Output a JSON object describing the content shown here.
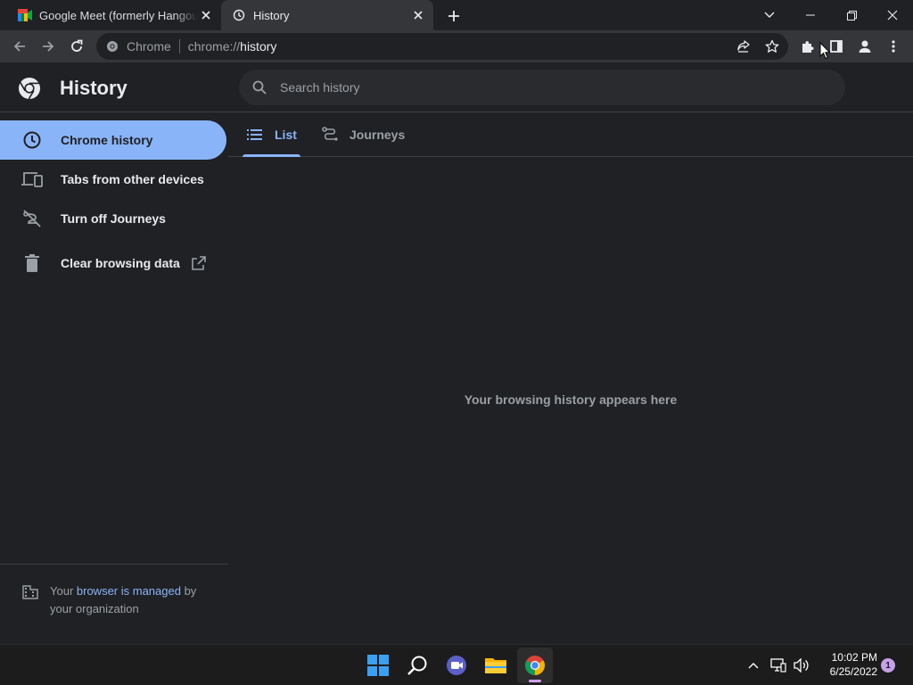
{
  "browser": {
    "tabs": [
      {
        "title": "Google Meet (formerly Hangouts)",
        "favicon": "google-meet-icon",
        "active": false
      },
      {
        "title": "History",
        "favicon": "history-clock-icon",
        "active": true
      }
    ],
    "omnibox": {
      "site_name": "Chrome",
      "url_scheme": "chrome://",
      "url_host": "history"
    }
  },
  "page": {
    "title": "History",
    "search": {
      "placeholder": "Search history"
    },
    "sidebar": {
      "items": [
        {
          "label": "Chrome history",
          "icon": "clock-icon",
          "selected": true
        },
        {
          "label": "Tabs from other devices",
          "icon": "devices-icon",
          "selected": false
        },
        {
          "label": "Turn off Journeys",
          "icon": "journeys-off-icon",
          "selected": false
        },
        {
          "label": "Clear browsing data",
          "icon": "trash-icon",
          "selected": false,
          "external": true
        }
      ],
      "managed": {
        "prefix": "Your ",
        "link": "browser is managed",
        "suffix_line1": " by",
        "line2": "your organization"
      }
    },
    "tabs": [
      {
        "label": "List",
        "icon": "list-icon",
        "active": true
      },
      {
        "label": "Journeys",
        "icon": "journeys-icon",
        "active": false
      }
    ],
    "empty_message": "Your browsing history appears here"
  },
  "taskbar": {
    "time": "10:02 PM",
    "date": "6/25/2022",
    "notification_count": "1"
  },
  "colors": {
    "accent": "#8ab4f8",
    "background": "#202124",
    "toolbar": "#35363a"
  }
}
